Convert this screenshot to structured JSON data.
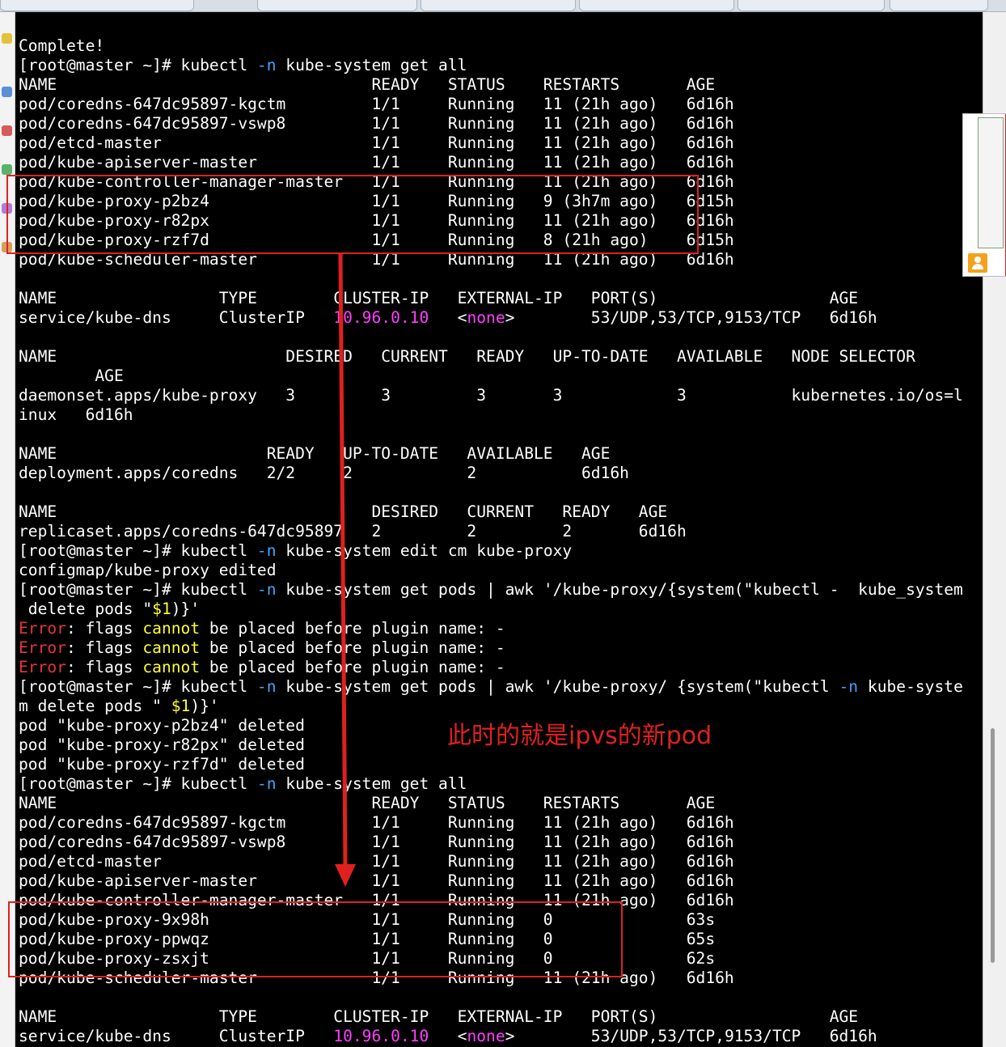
{
  "annotation": {
    "text": "此时的就是ipvs的新pod"
  },
  "colors": {
    "background": "#000000",
    "text": "#ffffff",
    "flag": "#3fa7ff",
    "ip": "#ff3fff",
    "error": "#e6363a",
    "keyword": "#ffff33",
    "annotation": "#e02020"
  },
  "terminal": {
    "lines": [
      [
        {
          "t": "Complete!"
        }
      ],
      [
        {
          "t": "[root@master ~]# kubectl "
        },
        {
          "t": "-n",
          "c": "cy"
        },
        {
          "t": " kube-system get all"
        }
      ],
      [
        {
          "t": "NAME                                 READY   STATUS    RESTARTS       AGE"
        }
      ],
      [
        {
          "t": "pod/coredns-647dc95897-kgctm         1/1     Running   11 (21h ago)   6d16h"
        }
      ],
      [
        {
          "t": "pod/coredns-647dc95897-vswp8         1/1     Running   11 (21h ago)   6d16h"
        }
      ],
      [
        {
          "t": "pod/etcd-master                      1/1     Running   11 (21h ago)   6d16h"
        }
      ],
      [
        {
          "t": "pod/kube-apiserver-master            1/1     Running   11 (21h ago)   6d16h"
        }
      ],
      [
        {
          "t": "pod/kube-controller-manager-master   1/1     Running   11 (21h ago)   6d16h"
        }
      ],
      [
        {
          "t": "pod/kube-proxy-p2bz4                 1/1     Running   9 (3h7m ago)   6d15h"
        }
      ],
      [
        {
          "t": "pod/kube-proxy-r82px                 1/1     Running   11 (21h ago)   6d16h"
        }
      ],
      [
        {
          "t": "pod/kube-proxy-rzf7d                 1/1     Running   8 (21h ago)    6d15h"
        }
      ],
      [
        {
          "t": "pod/kube-scheduler-master            1/1     Running   11 (21h ago)   6d16h"
        }
      ],
      [
        {
          "t": ""
        }
      ],
      [
        {
          "t": "NAME                 TYPE        CLUSTER-IP   EXTERNAL-IP   PORT(S)                  AGE"
        }
      ],
      [
        {
          "t": "service/kube-dns     ClusterIP   "
        },
        {
          "t": "10.96.0.10",
          "c": "mg"
        },
        {
          "t": "   <"
        },
        {
          "t": "none",
          "c": "mg"
        },
        {
          "t": ">        53/UDP,53/TCP,9153/TCP   6d16h"
        }
      ],
      [
        {
          "t": ""
        }
      ],
      [
        {
          "t": "NAME                        DESIRED   CURRENT   READY   UP-TO-DATE   AVAILABLE   NODE SELECTOR"
        }
      ],
      [
        {
          "t": "        AGE"
        }
      ],
      [
        {
          "t": "daemonset.apps/kube-proxy   3         3         3       3            3           kubernetes.io/os=l"
        }
      ],
      [
        {
          "t": "inux   6d16h"
        }
      ],
      [
        {
          "t": ""
        }
      ],
      [
        {
          "t": "NAME                      READY   UP-TO-DATE   AVAILABLE   AGE"
        }
      ],
      [
        {
          "t": "deployment.apps/coredns   2/2     2            2           6d16h"
        }
      ],
      [
        {
          "t": ""
        }
      ],
      [
        {
          "t": "NAME                                 DESIRED   CURRENT   READY   AGE"
        }
      ],
      [
        {
          "t": "replicaset.apps/coredns-647dc95897   2         2         2       6d16h"
        }
      ],
      [
        {
          "t": "[root@master ~]# kubectl "
        },
        {
          "t": "-n",
          "c": "cy"
        },
        {
          "t": " kube-system edit cm kube-proxy"
        }
      ],
      [
        {
          "t": "configmap/kube-proxy edited"
        }
      ],
      [
        {
          "t": "[root@master ~]# kubectl "
        },
        {
          "t": "-n",
          "c": "cy"
        },
        {
          "t": " kube-system get pods | awk '/kube-proxy/{system(\"kubectl -  kube_system"
        }
      ],
      [
        {
          "t": " delete pods \""
        },
        {
          "t": "$1",
          "c": "yl"
        },
        {
          "t": ")}'"
        }
      ],
      [
        {
          "t": "Error",
          "c": "rd"
        },
        {
          "t": ": flags "
        },
        {
          "t": "cannot",
          "c": "yl"
        },
        {
          "t": " be placed before plugin name: -"
        }
      ],
      [
        {
          "t": "Error",
          "c": "rd"
        },
        {
          "t": ": flags "
        },
        {
          "t": "cannot",
          "c": "yl"
        },
        {
          "t": " be placed before plugin name: -"
        }
      ],
      [
        {
          "t": "Error",
          "c": "rd"
        },
        {
          "t": ": flags "
        },
        {
          "t": "cannot",
          "c": "yl"
        },
        {
          "t": " be placed before plugin name: -"
        }
      ],
      [
        {
          "t": "[root@master ~]# kubectl "
        },
        {
          "t": "-n",
          "c": "cy"
        },
        {
          "t": " kube-system get pods | awk '/kube-proxy/ {system(\"kubectl "
        },
        {
          "t": "-n",
          "c": "cy"
        },
        {
          "t": " kube-syste"
        }
      ],
      [
        {
          "t": "m delete pods \" "
        },
        {
          "t": "$1",
          "c": "yl"
        },
        {
          "t": ")}'"
        }
      ],
      [
        {
          "t": "pod \"kube-proxy-p2bz4\" deleted"
        }
      ],
      [
        {
          "t": "pod \"kube-proxy-r82px\" deleted"
        }
      ],
      [
        {
          "t": "pod \"kube-proxy-rzf7d\" deleted"
        }
      ],
      [
        {
          "t": "[root@master ~]# kubectl "
        },
        {
          "t": "-n",
          "c": "cy"
        },
        {
          "t": " kube-system get all"
        }
      ],
      [
        {
          "t": "NAME                                 READY   STATUS    RESTARTS       AGE"
        }
      ],
      [
        {
          "t": "pod/coredns-647dc95897-kgctm         1/1     Running   11 (21h ago)   6d16h"
        }
      ],
      [
        {
          "t": "pod/coredns-647dc95897-vswp8         1/1     Running   11 (21h ago)   6d16h"
        }
      ],
      [
        {
          "t": "pod/etcd-master                      1/1     Running   11 (21h ago)   6d16h"
        }
      ],
      [
        {
          "t": "pod/kube-apiserver-master            1/1     Running   11 (21h ago)   6d16h"
        }
      ],
      [
        {
          "t": "pod/kube-controller-manager-master   1/1     Running   11 (21h ago)   6d16h"
        }
      ],
      [
        {
          "t": "pod/kube-proxy-9x98h                 1/1     Running   0              63s"
        }
      ],
      [
        {
          "t": "pod/kube-proxy-ppwqz                 1/1     Running   0              65s"
        }
      ],
      [
        {
          "t": "pod/kube-proxy-zsxjt                 1/1     Running   0              62s"
        }
      ],
      [
        {
          "t": "pod/kube-scheduler-master            1/1     Running   11 (21h ago)   6d16h"
        }
      ],
      [
        {
          "t": ""
        }
      ],
      [
        {
          "t": "NAME                 TYPE        CLUSTER-IP   EXTERNAL-IP   PORT(S)                  AGE"
        }
      ],
      [
        {
          "t": "service/kube-dns     ClusterIP   "
        },
        {
          "t": "10.96.0.10",
          "c": "mg"
        },
        {
          "t": "   <"
        },
        {
          "t": "none",
          "c": "mg"
        },
        {
          "t": ">        53/UDP,53/TCP,9153/TCP   6d16h"
        }
      ]
    ]
  }
}
